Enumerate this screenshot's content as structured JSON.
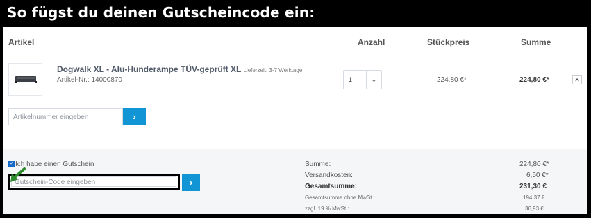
{
  "header": {
    "title": "So fügst du deinen Gutscheincode ein:"
  },
  "table": {
    "columns": [
      "Artikel",
      "Anzahl",
      "Stückpreis",
      "Summe"
    ],
    "item": {
      "name": "Dogwalk XL - Alu-Hunderampe TÜV-geprüft XL",
      "lieferzeit": "Lieferzeit: 3-7 Werktage",
      "article_number": "Artikel-Nr.: 14000870",
      "quantity": "1",
      "unit_price": "224,80 €*",
      "total": "224,80 €*",
      "remove_label": "✕"
    }
  },
  "article_input": {
    "placeholder": "Artikelnummer eingeben",
    "button_label": "›"
  },
  "voucher": {
    "checkbox_label": "Ich habe einen Gutschein",
    "checked": true,
    "placeholder": "Gutschein-Code eingeben",
    "button_label": "›"
  },
  "summary": {
    "summe_label": "Summe:",
    "summe_value": "224,80 €*",
    "versand_label": "Versandkosten:",
    "versand_value": "6,50 €*",
    "gesamt_label": "Gesamtsumme:",
    "gesamt_value": "231,30 €",
    "netto_label": "Gesamtsumme ohne MwSt.:",
    "netto_value": "194,37 €",
    "mwst_label": "zzgl. 19 % MwSt.:",
    "mwst_value": "36,93 €"
  },
  "colors": {
    "accent": "#1195d4",
    "header_bg": "#000000",
    "arrow": "#2e8b2e"
  }
}
